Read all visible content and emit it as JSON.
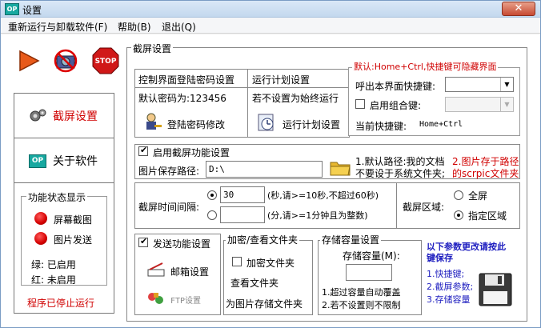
{
  "window": {
    "title": "设置",
    "app_icon": "OP",
    "close": "✕"
  },
  "menu": [
    "重新运行与卸载软件(F)",
    "帮助(B)",
    "退出(Q)"
  ],
  "toolbar": {
    "play": "play-icon",
    "forbid": "no-camera-icon",
    "stop": "STOP"
  },
  "nav": {
    "screenshot_settings": "截屏设置",
    "about": "关于软件",
    "about_icon": "OP"
  },
  "status": {
    "title": "功能状态显示",
    "screen_capture": "屏幕截图",
    "image_send": "图片发送",
    "green_legend": "绿: 已启用",
    "red_legend": "红: 未启用",
    "stopped": "程序已停止运行"
  },
  "main": {
    "title": "截屏设置",
    "password": {
      "header": "控制界面登陆密码设置",
      "default": "默认密码为:123456",
      "change": "登陆密码修改"
    },
    "plan": {
      "header": "运行计划设置",
      "note": "若不设置为始终运行",
      "button": "运行计划设置"
    },
    "hotkey": {
      "title": "默认:Home+Ctrl,快捷键可隐藏界面",
      "call_label": "呼出本界面快捷键:",
      "combo_label": "启用组合键:",
      "current_label": "当前快捷键:",
      "current_value": "Home+Ctrl"
    },
    "capture": {
      "enable_label": "启用截屏功能设置",
      "path_label": "图片保存路径:",
      "path_value": "D:\\",
      "note1_line1": "1.默认路径:我的文档",
      "note1_line2": "不要设于系统文件夹;",
      "note2_line1": "2.图片存于路径",
      "note2_line2": "的scrpic文件夹"
    },
    "interval": {
      "label": "截屏时间间隔:",
      "sec_value": "30",
      "sec_hint": "(秒,请>=10秒,不超过60秒)",
      "min_value": "",
      "min_hint": "(分,请>=1分钟且为整数)",
      "area_label": "截屏区域:",
      "full": "全屏",
      "specified": "指定区域"
    },
    "send": {
      "enable_label": "发送功能设置",
      "mail": "邮箱设置",
      "ftp": "FTP设置"
    },
    "encrypt": {
      "title": "加密/查看文件夹",
      "encrypt_label": "加密文件夹",
      "view": "查看文件夹",
      "storage_note": "为图片存储文件夹"
    },
    "storage": {
      "title": "存储容量设置",
      "capacity_label": "存储容量(M):",
      "capacity_value": "",
      "note1": "1.超过容量自动覆盖",
      "note2": "2.若不设置则不限制"
    },
    "save_note": {
      "title_line1": "以下参数更改请按此",
      "title_line2": "键保存",
      "item1": "1.快捷键;",
      "item2": "2.截屏参数;",
      "item3": "3.存储容量"
    }
  }
}
